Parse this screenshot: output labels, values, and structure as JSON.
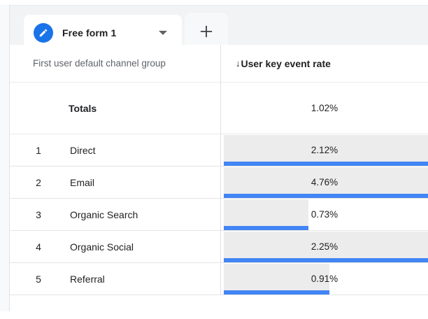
{
  "tabbar": {
    "tab": {
      "label": "Free form 1",
      "icon": "pencil-icon"
    },
    "add_tab": {
      "icon": "plus-icon"
    }
  },
  "table": {
    "dimension_header": "First user default channel group",
    "metric_header": "User key event rate",
    "sort_glyph": "↓",
    "totals": {
      "label": "Totals",
      "value": "1.02%"
    },
    "rows": [
      {
        "index": "1",
        "dimension": "Direct",
        "value": "2.12%",
        "percent": 2.12
      },
      {
        "index": "2",
        "dimension": "Email",
        "value": "4.76%",
        "percent": 4.76
      },
      {
        "index": "3",
        "dimension": "Organic Search",
        "value": "0.73%",
        "percent": 0.73
      },
      {
        "index": "4",
        "dimension": "Organic Social",
        "value": "2.25%",
        "percent": 2.25
      },
      {
        "index": "5",
        "dimension": "Referral",
        "value": "0.91%",
        "percent": 0.91
      }
    ]
  },
  "colors": {
    "accent_blue": "#1a73e8",
    "bar_blue": "#4285f4",
    "bar_gray": "#ececec",
    "tabbar_bg": "#f1f3f4"
  }
}
